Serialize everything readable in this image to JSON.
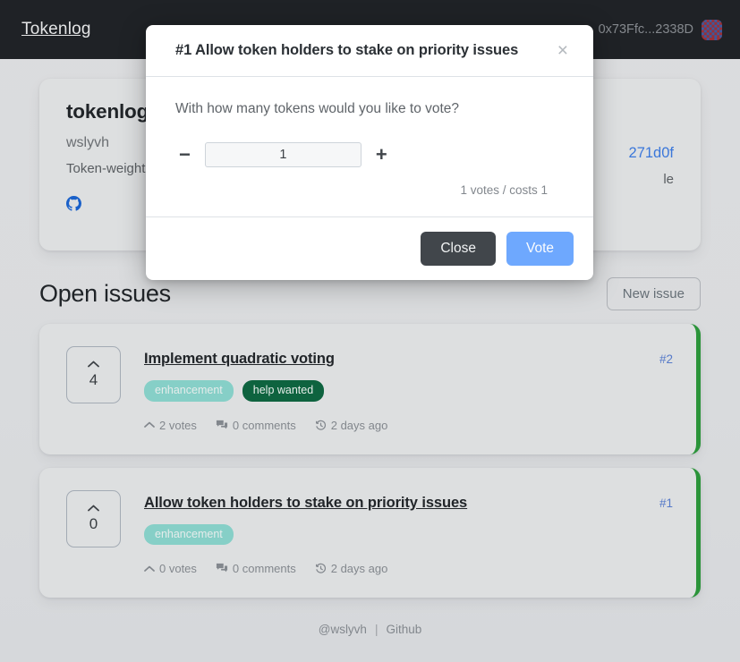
{
  "navbar": {
    "brand": "Tokenlog",
    "wallet_address": "0x73Ffc...2338D",
    "avatar_icon": "identicon-avatar"
  },
  "repo": {
    "name": "tokenlog",
    "owner": "wslyvh",
    "description": "Token-weighted backlog for your repo with on-chain vote tracking available",
    "contract_link": "271d0f",
    "contract_sub": "le",
    "github_icon": "github-icon"
  },
  "issues_section": {
    "title": "Open issues",
    "new_issue_label": "New issue",
    "items": [
      {
        "votes_box": "4",
        "title": "Implement quadratic voting",
        "number": "#2",
        "labels": [
          {
            "text": "enhancement",
            "bg": "#8fdcd4",
            "fg": "#f4fbfa"
          },
          {
            "text": "help wanted",
            "bg": "#0f6a43",
            "fg": "#f4fbf8"
          }
        ],
        "votes": "2 votes",
        "comments": "0 comments",
        "age": "2 days ago",
        "accent": "#2e9e3e"
      },
      {
        "votes_box": "0",
        "title": "Allow token holders to stake on priority issues",
        "number": "#1",
        "labels": [
          {
            "text": "enhancement",
            "bg": "#8fdcd4",
            "fg": "#f4fbfa"
          }
        ],
        "votes": "0 votes",
        "comments": "0 comments",
        "age": "2 days ago",
        "accent": "#2e9e3e"
      }
    ]
  },
  "footer": {
    "handle": "@wslyvh",
    "separator": "|",
    "github": "Github"
  },
  "modal": {
    "title": "#1 Allow token holders to stake on priority issues",
    "close_icon": "×",
    "question": "With how many tokens would you like to vote?",
    "decrement_label": "−",
    "increment_label": "+",
    "quantity": "1",
    "cost_note": "1 votes / costs 1",
    "close_label": "Close",
    "vote_label": "Vote"
  },
  "colors": {
    "navbar_bg": "#212529",
    "accent_green": "#2e9e3e",
    "primary_blue": "#6ea8fe",
    "link_blue": "#3f7fe8"
  }
}
